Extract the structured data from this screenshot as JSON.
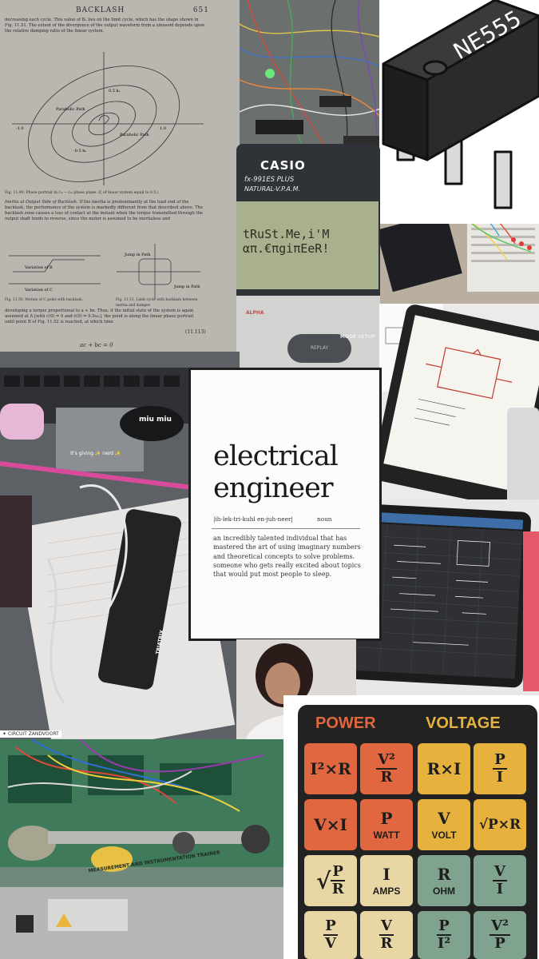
{
  "book": {
    "header_title": "BACKLASH",
    "page_number": "651",
    "intro": "decreasing each cycle. This value of Bₙ lies on the limit cycle, which has the shape shown in Fig. 11.51. The extent of the divergence of the output waveform from a sinusoid depends upon the relative damping ratio of the linear system.",
    "fig_labels": [
      "Parabolic Path",
      "Parabolic Path",
      "0.5 kₑ",
      "-0.5 kₑ",
      "-1.0",
      "1.0"
    ],
    "caption_1": "Fig. 11.49. Phase portrait in cₘ − ċₘ phase plane.",
    "caption_1b": "(ζ of linear system equal to 0.5.)",
    "section_title": "Inertia at Output Side of Backlash.",
    "section_text": "If the inertia is predominantly at the load end of the backlash, the performance of the system is markedly different from that described above. The backlash zone causes a loss of contact at the instant when the torque transmitted through the output shaft tends to reverse, since the motor is assumed to be inertialess and",
    "fig2_labels": [
      "Variation of B",
      "Variation of C",
      "Jump in Path",
      "Jump in Path"
    ],
    "caption_2": "Fig. 11.50. Motion of C point with backlash.",
    "caption_3": "Fig. 11.51. Limit cycle with backlash between inertia and damper.",
    "body_text": "developing a torque proportional to a + be. Thus, if the initial state of the system is again assumed at A [with c(0) = 0 and ċ(0) = 0.5ωₙ], the point is along the linear phase portrait until point B of Fig. 11.52 is reached, at which time",
    "equation": "ac + bc = 0",
    "equation_number": "(11.113)"
  },
  "calculator": {
    "brand": "CASIO",
    "model": "fx-991ES PLUS",
    "subtitle": "NATURAL-V.P.A.M.",
    "screen_line_1": "tRuSt.Me,i'M",
    "screen_line_2": "απ.€πgiπEeR!",
    "key_alpha": "ALPHA",
    "key_replay": "REPLAY",
    "key_mode": "MODE SETUP"
  },
  "chip": {
    "label": "NE555"
  },
  "desk": {
    "caption": "it's giving ✨ nerd ✨",
    "case_brand": "miu miu",
    "meter_brand": "TRIATRIX"
  },
  "card": {
    "word_line_1": "electrical",
    "word_line_2": "engineer",
    "pronunciation": "|ih-lek-tri-kuhl en-juh-neer|",
    "part_of_speech": "noun",
    "definition": "an incredibly talented individual that has mastered the art of using imaginary numbers and theoretical concepts to solve problems. someone who gets really excited about topics that would put most people to sleep."
  },
  "circuit_tag": "✦ CIRCUIT ZANDVOORT",
  "trainer": {
    "panel_label": "MEASUREMENT AND INSTRUMENTATION TRAINER"
  },
  "sticker": {
    "header_power": "POWER",
    "header_voltage": "VOLTAGE",
    "rows": [
      [
        "I²×R",
        "V²/R",
        "R×I",
        "P/I"
      ],
      [
        "V×I",
        "P",
        "V",
        "√P×R"
      ],
      [
        "√P/R",
        "I",
        "R",
        "V/I"
      ],
      [
        "P/V",
        "V/R",
        "P/I²",
        "V²/P"
      ]
    ],
    "units": {
      "watt": "WATT",
      "volt": "VOLT",
      "amps": "AMPS",
      "ohm": "OHM"
    }
  }
}
